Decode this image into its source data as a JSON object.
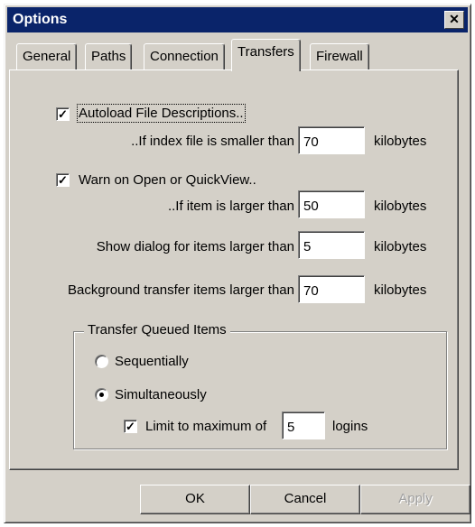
{
  "window": {
    "title": "Options",
    "close_glyph": "✕"
  },
  "tabs": [
    {
      "label": "General",
      "active": false
    },
    {
      "label": "Paths",
      "active": false
    },
    {
      "label": "Connection",
      "active": false
    },
    {
      "label": "Transfers",
      "active": true
    },
    {
      "label": "Firewall",
      "active": false
    }
  ],
  "transfers": {
    "autoload": {
      "label": "Autoload File Descriptions..",
      "checked": true,
      "check_glyph": "✓"
    },
    "index_size": {
      "label": "..If index file is smaller than",
      "value": "70",
      "unit": "kilobytes"
    },
    "warn_open": {
      "label": "Warn on Open or QuickView..",
      "checked": true,
      "check_glyph": "✓"
    },
    "item_larger": {
      "label": "..If item is larger than",
      "value": "50",
      "unit": "kilobytes"
    },
    "show_dialog": {
      "label": "Show dialog for items larger than",
      "value": "5",
      "unit": "kilobytes"
    },
    "background": {
      "label": "Background transfer items larger than",
      "value": "70",
      "unit": "kilobytes"
    },
    "queue": {
      "title": "Transfer Queued Items",
      "sequentially": {
        "label": "Sequentially",
        "selected": false
      },
      "simultaneously": {
        "label": "Simultaneously",
        "selected": true
      },
      "limit": {
        "label": "Limit to maximum of",
        "checked": true,
        "check_glyph": "✓",
        "value": "5",
        "unit": "logins"
      }
    }
  },
  "buttons": {
    "ok": "OK",
    "cancel": "Cancel",
    "apply": "Apply"
  }
}
